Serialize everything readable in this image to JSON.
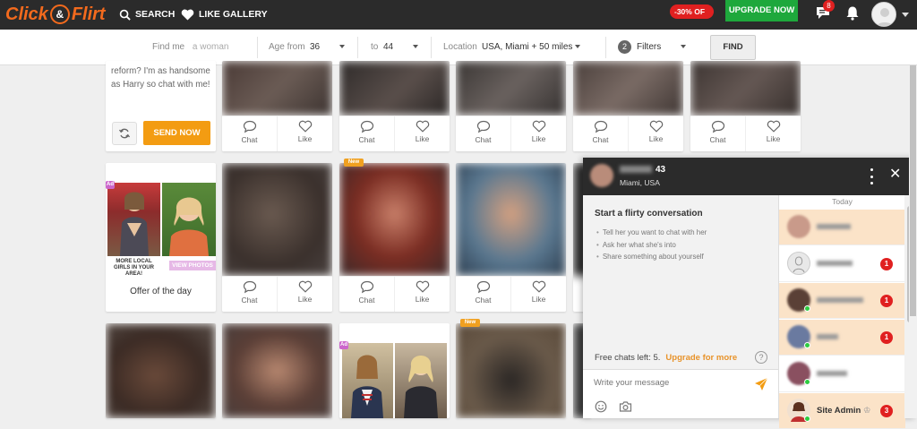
{
  "header": {
    "logo_text_left": "Click",
    "logo_amp": "&",
    "logo_text_right": "Flirt",
    "nav": [
      {
        "label": "SEARCH",
        "icon": "search-icon"
      },
      {
        "label": "LIKE GALLERY",
        "icon": "heart-icon"
      }
    ],
    "discount": "-30% OFF",
    "upgrade_label": "UPGRADE NOW",
    "messages_badge": "8",
    "accent": "#1ea83c"
  },
  "filters": {
    "find_me_label": "Find me",
    "find_me_value": "a woman",
    "age_from_label": "Age from",
    "age_from_value": "36",
    "age_to_label": "to",
    "age_to_value": "44",
    "location_label": "Location",
    "location_value": "USA, Miami + 50 miles",
    "filters_count": "2",
    "filters_label": "Filters",
    "find_button": "FIND"
  },
  "intro_card": {
    "text": "reform? I'm as handsome as Harry so chat with me!",
    "send_label": "SEND NOW"
  },
  "card_actions": {
    "chat": "Chat",
    "like": "Like"
  },
  "new_tag": "New",
  "offer": {
    "caption": "MORE LOCAL GIRLS IN YOUR AREA!",
    "view_photos": "VIEW PHOTOS",
    "title": "Offer of the day",
    "ad_tag": "Ad"
  },
  "chat": {
    "age": "43",
    "location": "Miami, USA",
    "start_title": "Start a flirty conversation",
    "tips": [
      "Tell her you want to chat with her",
      "Ask her what she's into",
      "Share something about yourself"
    ],
    "free_chats": "Free chats left: 5.",
    "upgrade_more": "Upgrade for more",
    "help": "?",
    "input_placeholder": "Write your message",
    "today": "Today",
    "contacts": [
      {
        "badge": "",
        "active": true
      },
      {
        "badge": "1",
        "active": false
      },
      {
        "badge": "1",
        "active": true
      },
      {
        "badge": "1",
        "active": true
      },
      {
        "badge": "",
        "active": false
      },
      {
        "name": "Site Admin",
        "badge": "3",
        "active": true
      }
    ]
  }
}
